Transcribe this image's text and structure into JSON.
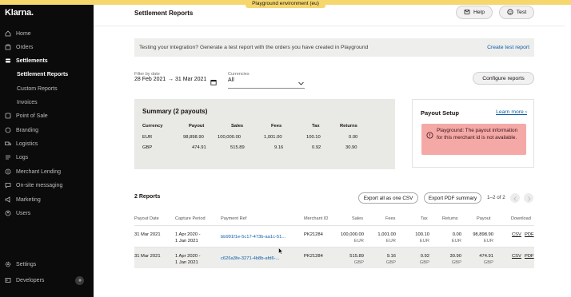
{
  "banner": "Playground environment (eu)",
  "sidebar": {
    "logo": "Klarna.",
    "items": [
      {
        "label": "Home",
        "icon": "home-icon"
      },
      {
        "label": "Orders",
        "icon": "orders-icon"
      },
      {
        "label": "Settlements",
        "icon": "settlements-icon",
        "active": true
      },
      {
        "label": "Settlement Reports",
        "sub": true,
        "active": true
      },
      {
        "label": "Custom Reports",
        "sub": true
      },
      {
        "label": "Invoices",
        "sub": true
      },
      {
        "label": "Point of Sale",
        "icon": "point-of-sale-icon"
      },
      {
        "label": "Branding",
        "icon": "branding-icon"
      },
      {
        "label": "Logistics",
        "icon": "logistics-icon"
      },
      {
        "label": "Logs",
        "icon": "logs-icon"
      },
      {
        "label": "Merchant Lending",
        "icon": "merchant-lending-icon"
      },
      {
        "label": "On-site messaging",
        "icon": "messaging-icon"
      },
      {
        "label": "Marketing",
        "icon": "marketing-icon"
      },
      {
        "label": "Users",
        "icon": "users-icon"
      }
    ],
    "settings": "Settings",
    "developers": "Developers"
  },
  "header": {
    "title": "Settlement Reports",
    "help_label": "Help",
    "test_label": "Test"
  },
  "info_bar": {
    "text": "Testing your integration? Generate a test report with the orders you have created in Playground",
    "link": "Create test report"
  },
  "filters": {
    "date_label": "Filter by date",
    "date_from": "28 Feb 2021",
    "date_arrow": "→",
    "date_to": "31 Mar 2021",
    "currency_label": "Currencies",
    "currency_value": "All",
    "configure_label": "Configure reports"
  },
  "summary": {
    "title": "Summary (2 payouts)",
    "headers": [
      "Currency",
      "Payout",
      "Sales",
      "Fees",
      "Tax",
      "Returns"
    ],
    "rows": [
      [
        "EUR",
        "98,898.90",
        "100,000.00",
        "1,001.00",
        "100.10",
        "0.00"
      ],
      [
        "GBP",
        "474.91",
        "515.89",
        "9.16",
        "0.92",
        "30.90"
      ]
    ]
  },
  "payout_setup": {
    "title": "Payout Setup",
    "link": "Learn more ›",
    "alert": "Playground: The payout information for this merchant id is not available."
  },
  "reports": {
    "count": "2 Reports",
    "export_csv": "Export all as one CSV",
    "export_pdf": "Export PDF summary",
    "pager": "1–2 of 2",
    "columns": [
      "Payout Date",
      "Capture Period",
      "Payment Ref",
      "Merchant ID",
      "Sales",
      "Fees",
      "Tax",
      "Returns",
      "Payout",
      "Download"
    ],
    "rows": [
      {
        "date": "31 Mar 2021",
        "period1": "1 Apr 2020 -",
        "period2": "1 Jan 2021",
        "ref": "bb991f1e-5c17-473b-aa1c-51...",
        "merchant": "PK21284",
        "sales": "100,000.00",
        "sales_cur": "EUR",
        "fees": "1,001.00",
        "fees_cur": "EUR",
        "tax": "100.10",
        "tax_cur": "EUR",
        "returns": "0.00",
        "returns_cur": "EUR",
        "payout": "98,898.90",
        "payout_cur": "EUR",
        "csv": "CSV",
        "pdf": "PDF"
      },
      {
        "date": "31 Mar 2021",
        "period1": "1 Apr 2020 -",
        "period2": "1 Jan 2021",
        "ref": "c626a3fe-3271-4b8b-afd6-...",
        "merchant": "PK21284",
        "sales": "515.89",
        "sales_cur": "GBP",
        "fees": "9.16",
        "fees_cur": "GBP",
        "tax": "0.92",
        "tax_cur": "GBP",
        "returns": "30.90",
        "returns_cur": "GBP",
        "payout": "474.91",
        "payout_cur": "GBP",
        "csv": "CSV",
        "pdf": "PDF"
      }
    ]
  },
  "colors": {
    "sidebar_bg": "#0b0b0b",
    "banner": "#f5d76e",
    "link": "#0b5ea8",
    "alert_bg": "#f4a9a7",
    "summary_bg": "#e9e9e6"
  }
}
